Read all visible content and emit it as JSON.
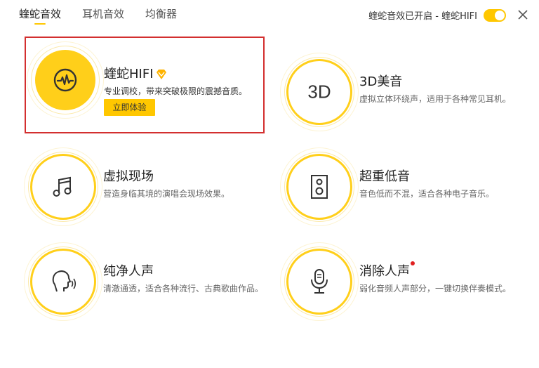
{
  "tabs": [
    {
      "label": "蝰蛇音效",
      "active": true
    },
    {
      "label": "耳机音效",
      "active": false
    },
    {
      "label": "均衡器",
      "active": false
    }
  ],
  "status": {
    "text": "蝰蛇音效已开启 - 蝰蛇HIFI",
    "enabled": true
  },
  "accent_color": "#ffc700",
  "cards": [
    {
      "id": "hifi",
      "title": "蝰蛇HIFI",
      "desc": "专业调校，带来突破极限的震撼音质。",
      "button": "立即体验",
      "icon": "waveform-icon",
      "badge": "vip-diamond-icon",
      "selected": true
    },
    {
      "id": "3d",
      "title": "3D美音",
      "desc": "虚拟立体环绕声，适用于各种常见耳机。",
      "icon_text": "3D"
    },
    {
      "id": "virtual",
      "title": "虚拟现场",
      "desc": "营造身临其境的演唱会现场效果。",
      "icon": "music-note-icon"
    },
    {
      "id": "bass",
      "title": "超重低音",
      "desc": "音色低而不混，适合各种电子音乐。",
      "icon": "speaker-icon"
    },
    {
      "id": "vocal",
      "title": "纯净人声",
      "desc": "清澈通透，适合各种流行、古典歌曲作品。",
      "icon": "voice-head-icon"
    },
    {
      "id": "remove",
      "title": "消除人声",
      "desc": "弱化音频人声部分，一键切换伴奏模式。",
      "icon": "microphone-icon",
      "new_badge": true
    }
  ]
}
